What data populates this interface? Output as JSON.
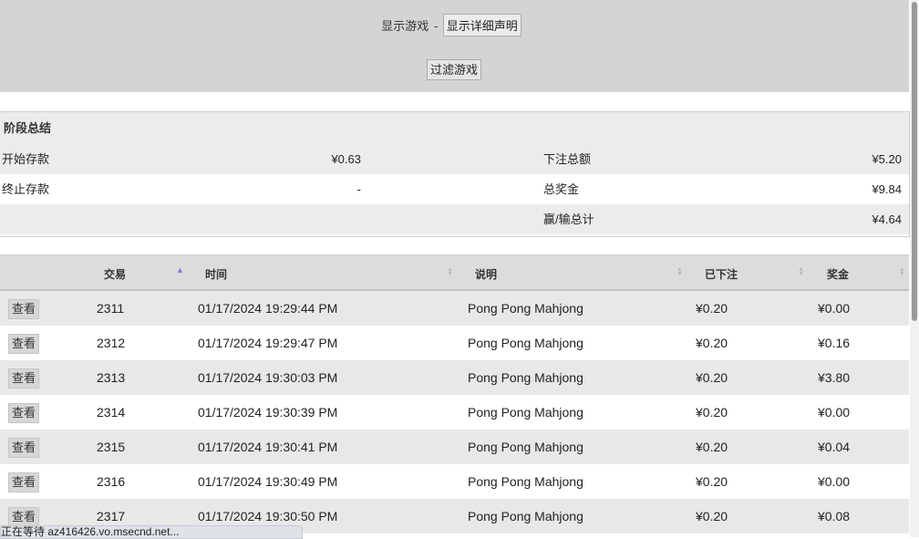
{
  "top": {
    "show_games_label": "显示游戏",
    "separator": "-",
    "show_details_label": "显示详细声明",
    "filter_label": "过滤游戏"
  },
  "summary": {
    "title": "阶段总结",
    "rows": [
      {
        "left_label": "开始存款",
        "left_value": "¥0.63",
        "right_label": "下注总额",
        "right_value": "¥5.20"
      },
      {
        "left_label": "终止存款",
        "left_value": "-",
        "right_label": "总奖金",
        "right_value": "¥9.84"
      },
      {
        "left_label": "",
        "left_value": "",
        "right_label": "赢/输总计",
        "right_value": "¥4.64"
      }
    ]
  },
  "table": {
    "headers": {
      "trade": "交易",
      "time": "时间",
      "desc": "说明",
      "bet": "已下注",
      "prize": "奖金"
    },
    "view_label": "查看",
    "rows": [
      {
        "id": "2311",
        "time": "01/17/2024 19:29:44 PM",
        "desc": "Pong Pong Mahjong",
        "bet": "¥0.20",
        "prize": "¥0.00"
      },
      {
        "id": "2312",
        "time": "01/17/2024 19:29:47 PM",
        "desc": "Pong Pong Mahjong",
        "bet": "¥0.20",
        "prize": "¥0.16"
      },
      {
        "id": "2313",
        "time": "01/17/2024 19:30:03 PM",
        "desc": "Pong Pong Mahjong",
        "bet": "¥0.20",
        "prize": "¥3.80"
      },
      {
        "id": "2314",
        "time": "01/17/2024 19:30:39 PM",
        "desc": "Pong Pong Mahjong",
        "bet": "¥0.20",
        "prize": "¥0.00"
      },
      {
        "id": "2315",
        "time": "01/17/2024 19:30:41 PM",
        "desc": "Pong Pong Mahjong",
        "bet": "¥0.20",
        "prize": "¥0.04"
      },
      {
        "id": "2316",
        "time": "01/17/2024 19:30:49 PM",
        "desc": "Pong Pong Mahjong",
        "bet": "¥0.20",
        "prize": "¥0.00"
      },
      {
        "id": "2317",
        "time": "01/17/2024 19:30:50 PM",
        "desc": "Pong Pong Mahjong",
        "bet": "¥0.20",
        "prize": "¥0.08"
      }
    ]
  },
  "status": {
    "text": "正在等待 az416426.vo.msecnd.net..."
  }
}
